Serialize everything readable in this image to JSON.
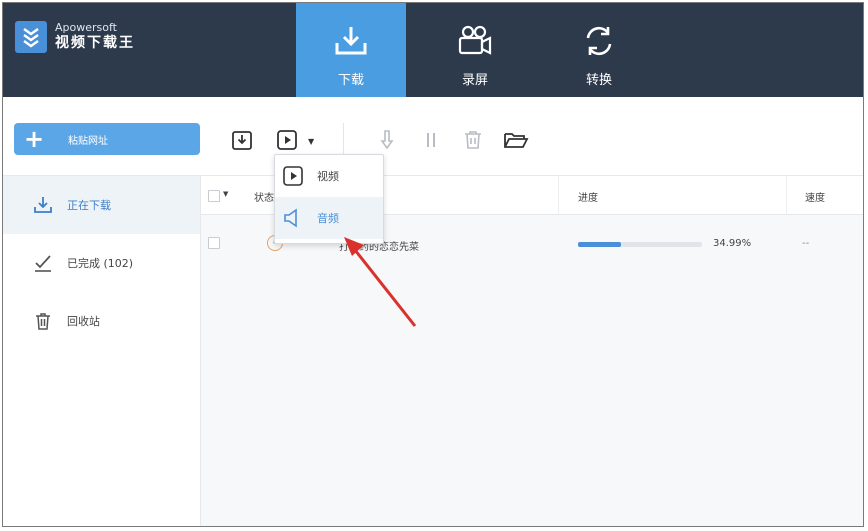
{
  "app": {
    "brand_en": "Apowersoft",
    "brand_cn": "视频下载王",
    "logo_icon": "stacked-chevrons-logo"
  },
  "nav": {
    "tabs": [
      {
        "label": "下载",
        "icon": "download-tray-icon",
        "active": true
      },
      {
        "label": "录屏",
        "icon": "video-camera-icon",
        "active": false
      },
      {
        "label": "转换",
        "icon": "refresh-cycle-icon",
        "active": false
      }
    ]
  },
  "toolbar": {
    "paste_label": "粘贴网址",
    "tools": [
      "import-icon",
      "video-play-icon",
      "start-download-icon",
      "pause-icon",
      "delete-icon",
      "open-folder-icon"
    ]
  },
  "dropdown": {
    "items": [
      {
        "label": "视频",
        "icon": "video-play-icon"
      },
      {
        "label": "音频",
        "icon": "speaker-icon"
      }
    ]
  },
  "sidebar": {
    "items": [
      {
        "label": "正在下载",
        "icon": "download-icon",
        "active": true
      },
      {
        "label": "已完成 (102)",
        "icon": "check-pen-icon",
        "active": false
      },
      {
        "label": "回收站",
        "icon": "trash-icon",
        "active": false
      }
    ]
  },
  "table": {
    "headers": {
      "status": "状态",
      "progress": "进度",
      "speed": "速度"
    },
    "rows": [
      {
        "name": "打开药的恋恋先菜",
        "progress_text": "34.99%",
        "progress": 0.3499,
        "speed": "--"
      }
    ]
  },
  "colors": {
    "header_bg": "#2d3a4c",
    "accent": "#4a9de0",
    "progress": "#4a8fd8",
    "arrow": "#d9322c"
  }
}
